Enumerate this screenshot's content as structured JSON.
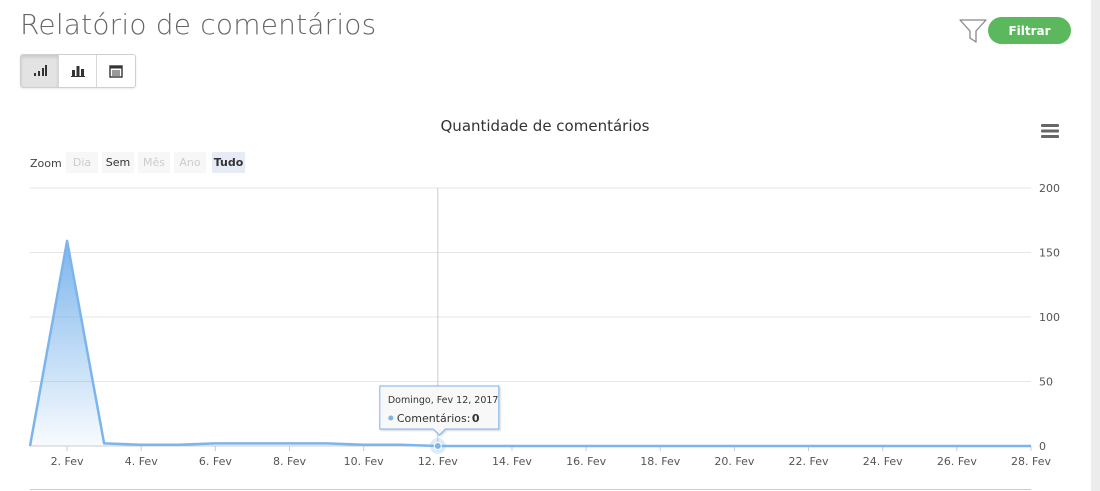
{
  "header": {
    "title": "Relatório de comentários",
    "filter_label": "Filtrar"
  },
  "toolbar": {
    "views": [
      {
        "icon": "line-chart-icon",
        "active": true
      },
      {
        "icon": "bar-chart-icon",
        "active": false
      },
      {
        "icon": "table-icon",
        "active": false
      }
    ]
  },
  "colors": {
    "series": "#7cb5ec",
    "filter_button": "#5cb85c"
  },
  "chart_data": {
    "type": "area",
    "title": "Quantidade de comentários",
    "zoom_label": "Zoom",
    "zoom_buttons": [
      {
        "label": "Dia",
        "state": "disabled"
      },
      {
        "label": "Sem",
        "state": "enabled"
      },
      {
        "label": "Mês",
        "state": "disabled"
      },
      {
        "label": "Ano",
        "state": "disabled"
      },
      {
        "label": "Tudo",
        "state": "selected"
      }
    ],
    "x": [
      "2017-02-01",
      "2017-02-02",
      "2017-02-03",
      "2017-02-04",
      "2017-02-05",
      "2017-02-06",
      "2017-02-07",
      "2017-02-08",
      "2017-02-09",
      "2017-02-10",
      "2017-02-11",
      "2017-02-12",
      "2017-02-13",
      "2017-02-14",
      "2017-02-15",
      "2017-02-16",
      "2017-02-17",
      "2017-02-18",
      "2017-02-19",
      "2017-02-20",
      "2017-02-21",
      "2017-02-22",
      "2017-02-23",
      "2017-02-24",
      "2017-02-25",
      "2017-02-26",
      "2017-02-27",
      "2017-02-28"
    ],
    "series": [
      {
        "name": "Comentários",
        "values": [
          0,
          159,
          2,
          1,
          1,
          2,
          2,
          2,
          2,
          1,
          1,
          0,
          0,
          0,
          0,
          0,
          0,
          0,
          0,
          0,
          0,
          0,
          0,
          0,
          0,
          0,
          0,
          0
        ]
      }
    ],
    "xticks": [
      "2. Fev",
      "4. Fev",
      "6. Fev",
      "8. Fev",
      "10. Fev",
      "12. Fev",
      "14. Fev",
      "16. Fev",
      "18. Fev",
      "20. Fev",
      "22. Fev",
      "24. Fev",
      "26. Fev",
      "28. Fev"
    ],
    "yticks": [
      0,
      50,
      100,
      150,
      200
    ],
    "ylim": [
      0,
      200
    ],
    "grid": true,
    "y_axis_side": "right",
    "tooltip": {
      "date": "Domingo, Fev 12, 2017",
      "series_label": "Comentários:",
      "value": "0",
      "x": "2017-02-12"
    }
  }
}
